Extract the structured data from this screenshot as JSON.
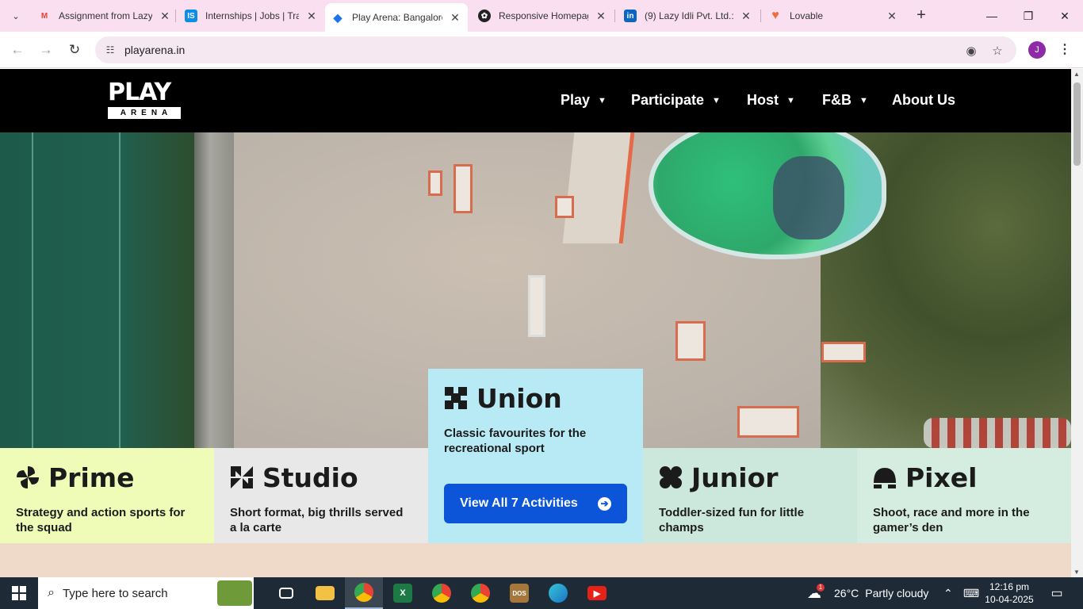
{
  "browser": {
    "tabs": [
      {
        "title": "Assignment from Lazy",
        "favicon": "gmail-icon",
        "favicon_glyph": "M",
        "favicon_color": "#ea4335"
      },
      {
        "title": "Internships | Jobs | Tra",
        "favicon": "internshala-icon",
        "favicon_glyph": "IS",
        "favicon_color": "#0a8ee8"
      },
      {
        "title": "Play Arena: Bangalore",
        "favicon": "playarena-icon",
        "favicon_glyph": "◆",
        "favicon_color": "#1a73e8",
        "active": true
      },
      {
        "title": "Responsive Homepag",
        "favicon": "openai-icon",
        "favicon_glyph": "✿",
        "favicon_color": "#222222"
      },
      {
        "title": "(9) Lazy Idli Pvt. Ltd.:",
        "favicon": "linkedin-icon",
        "favicon_glyph": "in",
        "favicon_color": "#0a66c2"
      },
      {
        "title": "Lovable",
        "favicon": "lovable-icon",
        "favicon_glyph": "♥",
        "favicon_color": "#f26b3a"
      }
    ],
    "new_tab_label": "+",
    "url": "playarena.in",
    "profile_initial": "J"
  },
  "site": {
    "logo_top": "PLAY",
    "logo_bottom": "ARENA",
    "nav": [
      {
        "label": "Play",
        "has_dropdown": true
      },
      {
        "label": "Participate",
        "has_dropdown": true
      },
      {
        "label": "Host",
        "has_dropdown": true
      },
      {
        "label": "F&B",
        "has_dropdown": true
      },
      {
        "label": "About Us",
        "has_dropdown": false
      }
    ],
    "categories": [
      {
        "title": "Prime",
        "description": "Strategy and action sports for the squad",
        "color": "#eefcb8",
        "icon": "pinwheel-icon"
      },
      {
        "title": "Studio",
        "description": "Short format, big thrills served a la carte",
        "color": "#e8e8e8",
        "icon": "bowtie-icon"
      },
      {
        "title": "Union",
        "description": "Classic favourites for the recreational sport",
        "color": "#b8eaf6",
        "icon": "cross-blocks-icon",
        "button_label": "View All 7 Activities"
      },
      {
        "title": "Junior",
        "description": "Toddler-sized fun for little champs",
        "color": "#cce8dc",
        "icon": "rounded-square-icon"
      },
      {
        "title": "Pixel",
        "description": "Shoot, race and more in the gamer’s den",
        "color": "#d5ece0",
        "icon": "helmet-icon"
      }
    ]
  },
  "taskbar": {
    "search_placeholder": "Type here to search",
    "weather_temp": "26°C",
    "weather_desc": "Partly cloudy",
    "weather_badge": "1",
    "time": "12:16 pm",
    "date": "10-04-2025"
  }
}
